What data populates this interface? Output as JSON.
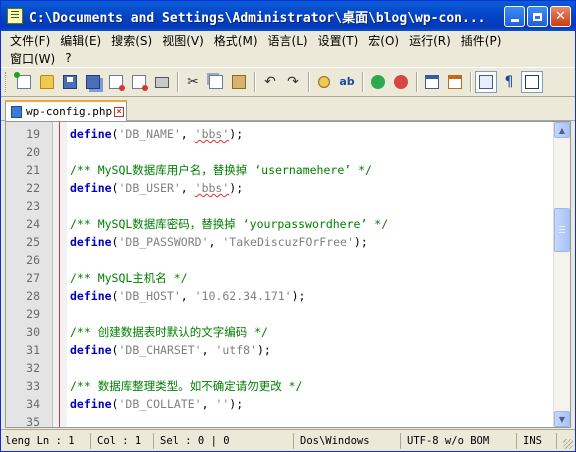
{
  "window": {
    "title": "C:\\Documents and Settings\\Administrator\\桌面\\blog\\wp-con..."
  },
  "menu": {
    "row1": [
      {
        "label": "文件(F)"
      },
      {
        "label": "编辑(E)"
      },
      {
        "label": "搜索(S)"
      },
      {
        "label": "视图(V)"
      },
      {
        "label": "格式(M)"
      },
      {
        "label": "语言(L)"
      },
      {
        "label": "设置(T)"
      },
      {
        "label": "宏(O)"
      },
      {
        "label": "运行(R)"
      },
      {
        "label": "插件(P)"
      }
    ],
    "row2": [
      {
        "label": "窗口(W)"
      },
      {
        "label": "?"
      }
    ]
  },
  "toolbar": {
    "icons": [
      "new-file-icon",
      "open-folder-icon",
      "save-icon",
      "save-all-icon",
      "close-file-icon",
      "close-all-icon",
      "print-icon",
      "cut-icon",
      "copy-icon",
      "paste-icon",
      "undo-icon",
      "redo-icon",
      "find-icon",
      "replace-icon",
      "zoom-in-icon",
      "zoom-out-icon",
      "sync-vertical-icon",
      "sync-horizontal-icon",
      "word-wrap-icon",
      "show-all-chars-icon",
      "indent-guide-icon"
    ]
  },
  "tabs": [
    {
      "label": "wp-config.php"
    }
  ],
  "editor": {
    "lines": [
      {
        "num": "19",
        "parts": [
          [
            "kw",
            "define"
          ],
          [
            "op",
            "("
          ],
          [
            "str",
            "'DB_NAME'"
          ],
          [
            "op",
            ", "
          ],
          [
            "str",
            "'bbs'"
          ],
          [
            "op",
            ");"
          ]
        ]
      },
      {
        "num": "20",
        "parts": []
      },
      {
        "num": "21",
        "parts": [
          [
            "cmt",
            "/** MySQL数据库用户名，替换掉 ‘usernamehere’ */"
          ]
        ]
      },
      {
        "num": "22",
        "parts": [
          [
            "kw",
            "define"
          ],
          [
            "op",
            "("
          ],
          [
            "str",
            "'DB_USER'"
          ],
          [
            "op",
            ", "
          ],
          [
            "str",
            "'bbs'"
          ],
          [
            "op",
            ");"
          ]
        ]
      },
      {
        "num": "23",
        "parts": []
      },
      {
        "num": "24",
        "parts": [
          [
            "cmt",
            "/** MySQL数据库密码，替换掉 ‘yourpasswordhere’ */"
          ]
        ]
      },
      {
        "num": "25",
        "parts": [
          [
            "kw",
            "define"
          ],
          [
            "op",
            "("
          ],
          [
            "str",
            "'DB_PASSWORD'"
          ],
          [
            "op",
            ", "
          ],
          [
            "str",
            "'TakeDiscuzFOrFree'"
          ],
          [
            "op",
            ");"
          ]
        ]
      },
      {
        "num": "26",
        "parts": []
      },
      {
        "num": "27",
        "parts": [
          [
            "cmt",
            "/** MySQL主机名 */"
          ]
        ]
      },
      {
        "num": "28",
        "parts": [
          [
            "kw",
            "define"
          ],
          [
            "op",
            "("
          ],
          [
            "str",
            "'DB_HOST'"
          ],
          [
            "op",
            ", "
          ],
          [
            "str",
            "'10.62.34.171'"
          ],
          [
            "op",
            ");"
          ]
        ]
      },
      {
        "num": "29",
        "parts": []
      },
      {
        "num": "30",
        "parts": [
          [
            "cmt",
            "/** 创建数据表时默认的文字编码 */"
          ]
        ]
      },
      {
        "num": "31",
        "parts": [
          [
            "kw",
            "define"
          ],
          [
            "op",
            "("
          ],
          [
            "str",
            "'DB_CHARSET'"
          ],
          [
            "op",
            ", "
          ],
          [
            "str",
            "'utf8'"
          ],
          [
            "op",
            ");"
          ]
        ]
      },
      {
        "num": "32",
        "parts": []
      },
      {
        "num": "33",
        "parts": [
          [
            "cmt",
            "/** 数据库整理类型。如不确定请勿更改 */"
          ]
        ]
      },
      {
        "num": "34",
        "parts": [
          [
            "kw",
            "define"
          ],
          [
            "op",
            "("
          ],
          [
            "str",
            "'DB_COLLATE'"
          ],
          [
            "op",
            ", "
          ],
          [
            "str",
            "''"
          ],
          [
            "op",
            ");"
          ]
        ]
      },
      {
        "num": "35",
        "parts": []
      }
    ]
  },
  "statusbar": {
    "length": "leng Ln : 1",
    "col": "Col : 1",
    "sel": "Sel : 0 | 0",
    "eol": "Dos\\Windows",
    "encoding": "UTF-8 w/o BOM",
    "mode": "INS"
  },
  "colors": {
    "keyword": "#0000c0",
    "string": "#808080",
    "comment": "#008000",
    "titlebar": "#0447c7"
  }
}
